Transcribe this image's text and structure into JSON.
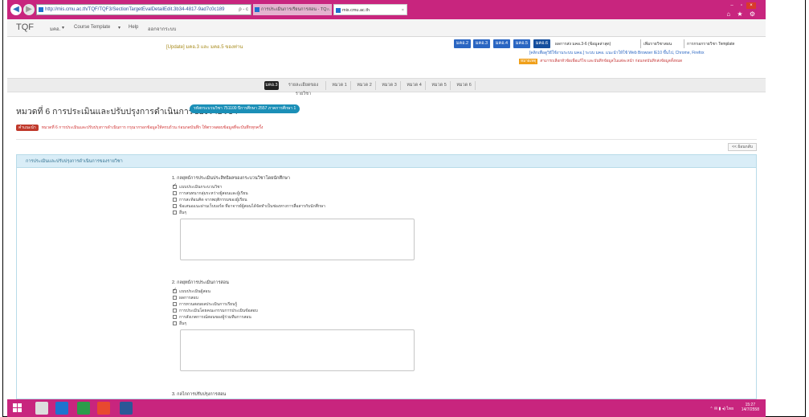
{
  "browser": {
    "url": "http://mis.cmu.ac.th/TQF/TQF3/SectionTargetEvalDetailEdit.3b34-4817-9ad7c0c189",
    "url_tools": "ρ - c",
    "tabs": [
      {
        "label": "การประเมินการเรียนการสอน - TQ..."
      },
      {
        "label": "mis.cmu.ac.th"
      }
    ],
    "tab_close": "×",
    "window_controls": [
      "–",
      "▫",
      "×"
    ],
    "icons_text": "⌂ ★ ⚙"
  },
  "navbar": {
    "brand": "TQF",
    "menu": [
      "มคอ.",
      "Course Template",
      "Help",
      "ออกจากระบบ"
    ]
  },
  "header": {
    "update_link": "[Update] มคอ.3 และ มคอ.5 ของท่าน",
    "buttons": [
      {
        "label": "มคอ.2"
      },
      {
        "label": "มคอ.3"
      },
      {
        "label": "มคอ.4"
      },
      {
        "label": "มคอ.5"
      },
      {
        "label": "มคอ.6"
      }
    ],
    "links": [
      "ผลการส่ง มคอ.3-6 (ข้อมูลล่าสุด)",
      "เพิ่มรายวิชาสอน",
      "การกรอกรายวิชา Template"
    ],
    "help_line": "[คลิกเพื่อดูวิธีใช้งานระบบ มคอ.] ระบบ มคอ. แนะนำให้ใช้ Web Browser IE10 ขึ้นไป, Chrome, Firefox",
    "note_badge": "หมายเหตุ",
    "note_text": "สามารถเลือกหัวข้อเพื่อแก้ไข และบันทึกข้อมูลในแต่ละหน้า ก่อนกดบันทึกส่งข้อมูลทั้งหมด"
  },
  "section_tabs": [
    {
      "label": "มคอ.3"
    },
    {
      "label": "รายละเอียดของรายวิชา"
    },
    {
      "label": "หมวด 1"
    },
    {
      "label": "หมวด 2"
    },
    {
      "label": "หมวด 3"
    },
    {
      "label": "หมวด 4"
    },
    {
      "label": "หมวด 5"
    },
    {
      "label": "หมวด 6"
    }
  ],
  "page": {
    "title": "หมวดที่ 6 การประเมินและปรับปรุงการดำเนินการของรายวิชา",
    "badge": "รหัสกระบวนวิชา 751100 ปีการศึกษา 2557 ภาคการศึกษา 1",
    "alert_badge": "คำแนะนำ",
    "alert_text": "หมวดที่ 6 การประเมินและปรับปรุงการดำเนินการ กรุณากรอกข้อมูลให้ครบถ้วน ก่อนกดบันทึก ให้ตรวจสอบข้อมูลที่จะบันทึกทุกครั้ง",
    "back_button": "<< ย้อนกลับ"
  },
  "panel": {
    "heading": "การประเมินและปรับปรุงการดำเนินการของรายวิชา",
    "questions": [
      {
        "title": "1. กลยุทธ์การประเมินประสิทธิผลของกระบวนวิชาโดยนักศึกษา",
        "options": [
          {
            "label": "แบบประเมินกระบวนวิชา",
            "checked": true
          },
          {
            "label": "การสนทนากลุ่มระหว่างผู้สอนและผู้เรียน",
            "checked": false
          },
          {
            "label": "การสะท้อนคิด จากพฤติกรรมของผู้เรียน",
            "checked": false
          },
          {
            "label": "ข้อเสนอแนะผ่านเว็บบอร์ด ที่อาจารย์ผู้สอนได้จัดทำเป็นช่องทางการสื่อสารกับนักศึกษา",
            "checked": false
          },
          {
            "label": "อื่นๆ",
            "checked": false
          }
        ]
      },
      {
        "title": "2. กลยุทธ์การประเมินการสอน",
        "options": [
          {
            "label": "แบบประเมินผู้สอน",
            "checked": true
          },
          {
            "label": "ผลการสอบ",
            "checked": false
          },
          {
            "label": "การทวนสอบผลประเมินการเรียนรู้",
            "checked": false
          },
          {
            "label": "การประเมินโดยคณะกรรมการประเมินข้อสอบ",
            "checked": false
          },
          {
            "label": "การสังเกตการณ์สอนของผู้ร่วมทีมการสอน",
            "checked": false
          },
          {
            "label": "อื่นๆ",
            "checked": false
          }
        ]
      },
      {
        "title": "3. กลไกการปรับปรุงการสอน"
      }
    ]
  },
  "taskbar": {
    "tray": "⌃ ✉ ▮ ◂) ไทย",
    "time": "15:27",
    "date": "14/7/2558"
  }
}
